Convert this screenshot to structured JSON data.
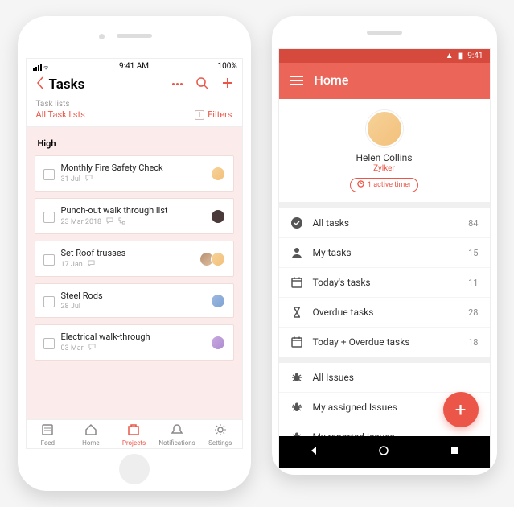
{
  "ios": {
    "status": {
      "time": "9:41 AM",
      "battery": "100%"
    },
    "header": {
      "title": "Tasks"
    },
    "filter": {
      "label": "Task lists",
      "value": "All Task lists",
      "filters_label": "Filters",
      "filters_count": "1"
    },
    "section": "High",
    "tasks": [
      {
        "title": "Monthly Fire Safety Check",
        "date": "31 Jul",
        "comments": true,
        "avatars": [
          "a1"
        ]
      },
      {
        "title": "Punch-out walk through list",
        "date": "23 Mar 2018",
        "comments": true,
        "subtasks": true,
        "avatars": [
          "a2"
        ]
      },
      {
        "title": "Set Roof trusses",
        "date": "17 Jan",
        "comments": true,
        "avatars": [
          "a3",
          "a1"
        ]
      },
      {
        "title": "Steel Rods",
        "date": "28 Jul",
        "comments": false,
        "avatars": [
          "a4"
        ]
      },
      {
        "title": "Electrical walk-through",
        "date": "03 Mar",
        "comments": true,
        "avatars": [
          "a5"
        ]
      }
    ],
    "tabs": [
      {
        "label": "Feed"
      },
      {
        "label": "Home"
      },
      {
        "label": "Projects"
      },
      {
        "label": "Notifications"
      },
      {
        "label": "Settings"
      }
    ],
    "active_tab": 2
  },
  "android": {
    "status": {
      "time": "9:41"
    },
    "appbar": {
      "title": "Home"
    },
    "profile": {
      "name": "Helen Collins",
      "org": "Zylker",
      "timer": "1 active timer"
    },
    "task_rows": [
      {
        "icon": "check-circle",
        "label": "All tasks",
        "count": "84"
      },
      {
        "icon": "user",
        "label": "My tasks",
        "count": "15"
      },
      {
        "icon": "calendar",
        "label": "Today's tasks",
        "count": "11"
      },
      {
        "icon": "hourglass",
        "label": "Overdue tasks",
        "count": "28"
      },
      {
        "icon": "calendar",
        "label": "Today + Overdue tasks",
        "count": "18"
      }
    ],
    "issue_rows": [
      {
        "icon": "bug",
        "label": "All Issues"
      },
      {
        "icon": "bug",
        "label": "My assigned Issues"
      },
      {
        "icon": "bug",
        "label": "My reported Issues"
      }
    ]
  },
  "colors": {
    "accent": "#eb5648"
  }
}
